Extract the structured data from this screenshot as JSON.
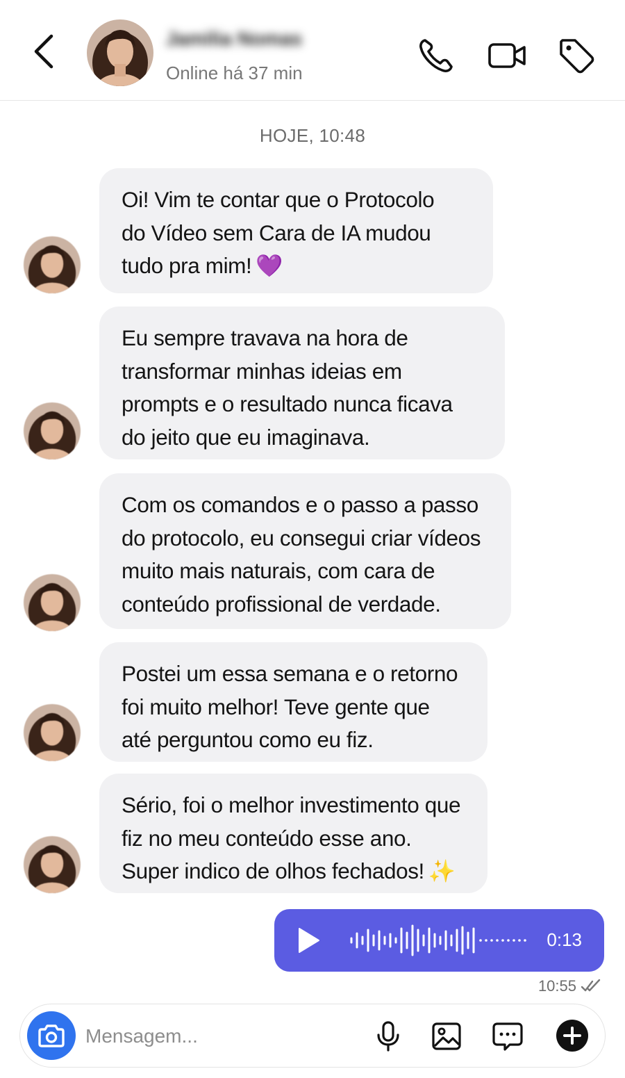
{
  "header": {
    "contact_name": "Jamilia Nomas",
    "status": "Online há 37 min"
  },
  "chat": {
    "date_separator": "HOJE, 10:48",
    "messages": [
      {
        "lines": [
          "Oi! Vim te contar que o Protocolo",
          "do Vídeo sem Cara de IA mudou",
          "tudo pra mim!"
        ],
        "emoji": "💜"
      },
      {
        "lines": [
          "Eu sempre travava na hora de",
          "transformar minhas ideias em",
          "prompts e o resultado nunca ficava",
          "do jeito que eu imaginava."
        ]
      },
      {
        "lines": [
          "Com os comandos e o passo a passo",
          "do protocolo, eu consegui criar vídeos",
          "muito mais naturais, com cara de",
          "conteúdo profissional de verdade."
        ]
      },
      {
        "lines": [
          "Postei um essa semana e o retorno",
          "foi muito melhor! Teve gente que",
          "até perguntou como eu fiz."
        ]
      },
      {
        "lines": [
          "Sério, foi o melhor investimento que",
          "fiz no meu conteúdo esse ano.",
          "Super indico de olhos fechados!"
        ],
        "emoji": "✨"
      }
    ],
    "voice_message": {
      "duration": "0:13",
      "time": "10:55",
      "color": "#5b5ce2"
    }
  },
  "composer": {
    "placeholder": "Mensagem...",
    "accent": "#2f73ee"
  },
  "icons": [
    "back-arrow-icon",
    "phone-icon",
    "video-camera-icon",
    "tag-icon",
    "play-icon",
    "waveform-icon",
    "double-check-icon",
    "camera-icon",
    "microphone-icon",
    "image-icon",
    "sticker-icon",
    "plus-icon"
  ]
}
